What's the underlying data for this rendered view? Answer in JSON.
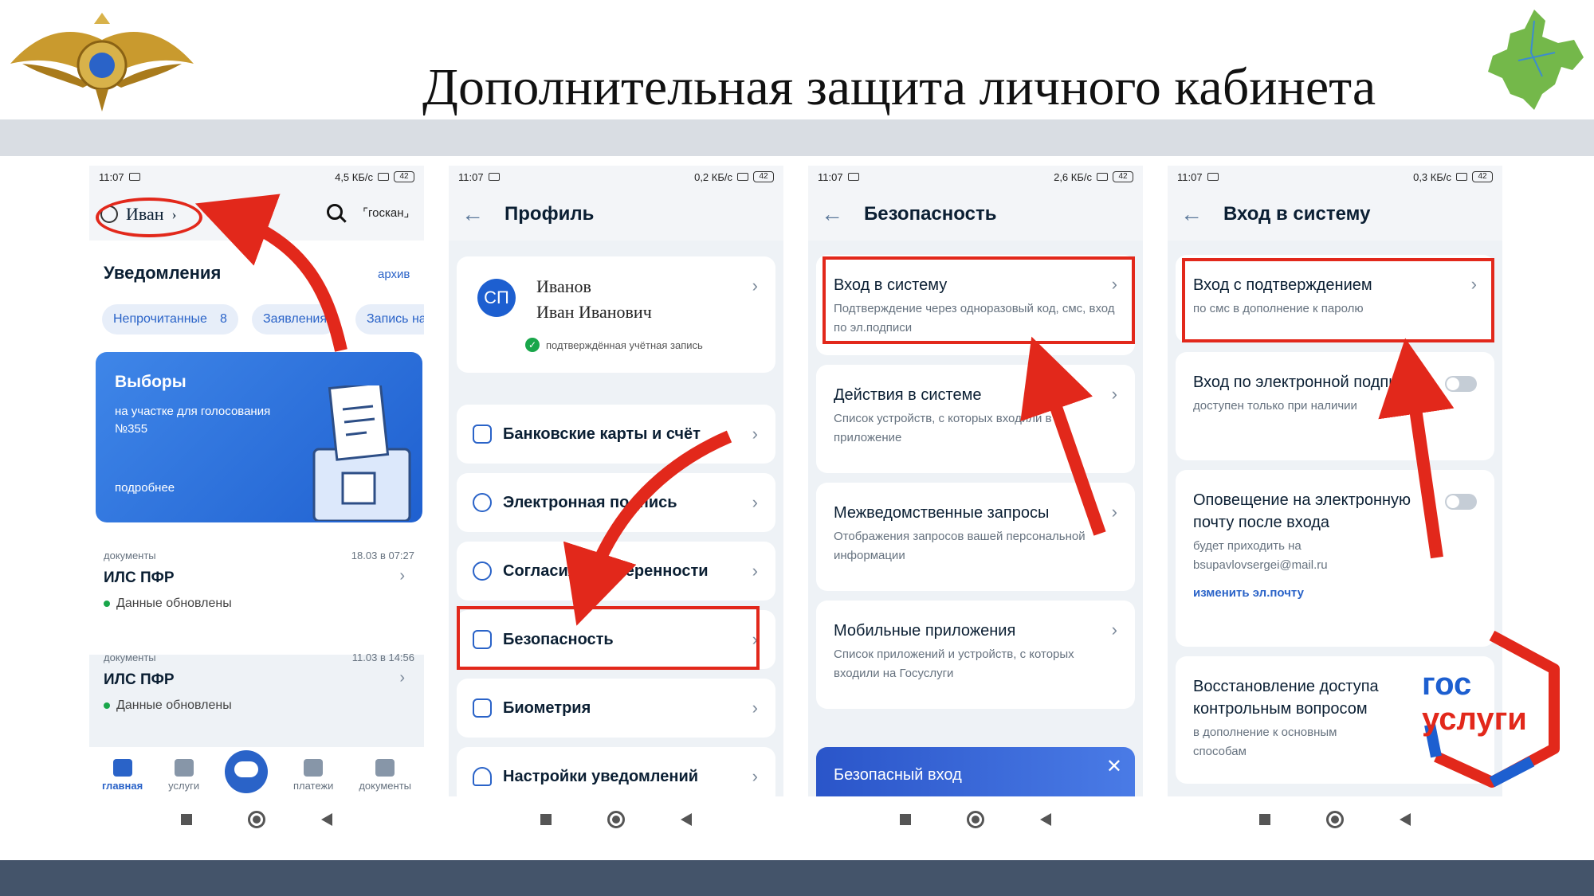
{
  "slide": {
    "title": "Дополнительная защита личного кабинета"
  },
  "status": {
    "time": "11:07",
    "speed1": "4,5 КБ/с",
    "speed2": "0,2 КБ/с",
    "speed3": "2,6 КБ/с",
    "speed4": "0,3 КБ/с",
    "battery": "42"
  },
  "home": {
    "user_name": "Иван",
    "goscan": "⌜госкан⌟",
    "notifications_title": "Уведомления",
    "archive": "архив",
    "pills": [
      {
        "label": "Непрочитанные",
        "count": "8"
      },
      {
        "label": "Заявления"
      },
      {
        "label": "Запись на"
      }
    ],
    "banner": {
      "title": "Выборы",
      "subtitle": "на участке для голосования №355",
      "more": "подробнее"
    },
    "docs": [
      {
        "category": "документы",
        "date": "18.03 в 07:27",
        "title": "ИЛС ПФР",
        "status": "Данные обновлены"
      },
      {
        "category": "документы",
        "date": "11.03 в 14:56",
        "title": "ИЛС ПФР",
        "status": "Данные обновлены"
      }
    ],
    "tabs": [
      "главная",
      "услуги",
      "платежи",
      "документы"
    ]
  },
  "profile": {
    "title": "Профиль",
    "avatar": "СП",
    "last_name": "Иванов",
    "full_name": "Иван Иванович",
    "verified": "подтверждённая учётная запись",
    "menu": [
      "Банковские карты и счёт",
      "Электронная подпись",
      "Согласия и доверенности",
      "Безопасность",
      "Биометрия",
      "Настройки уведомлений"
    ]
  },
  "security": {
    "title": "Безопасность",
    "items": [
      {
        "title": "Вход в систему",
        "subtitle": "Подтверждение через одноразовый код, смс, вход по эл.подписи"
      },
      {
        "title": "Действия в системе",
        "subtitle": "Список устройств, с которых входили в приложение"
      },
      {
        "title": "Межведомственные запросы",
        "subtitle": "Отображения запросов вашей персональной информации"
      },
      {
        "title": "Мобильные приложения",
        "subtitle": "Список приложений и устройств, с которых входили на Госуслуги"
      }
    ],
    "promo": "Безопасный вход"
  },
  "login": {
    "title": "Вход в систему",
    "items": [
      {
        "title": "Вход с подтверждением",
        "subtitle": "по смс в дополнение к паролю"
      },
      {
        "title": "Вход по электронной подписи",
        "subtitle": "доступен только при наличии"
      },
      {
        "title": "Оповещение на электронную почту после входа",
        "subtitle": "будет приходить на bsupavlovsergei@mail.ru",
        "link": "изменить эл.почту"
      },
      {
        "title": "Восстановление доступа контрольным вопросом",
        "subtitle": "в дополнение к основным способам"
      }
    ]
  },
  "gosuslugi_logo": {
    "line1": "гос",
    "line2": "услуги"
  },
  "colors": {
    "accent_red": "#e2281b",
    "brand_blue": "#1d5fd0",
    "band_gray": "#d9dde3",
    "band_dark": "#44546a"
  }
}
